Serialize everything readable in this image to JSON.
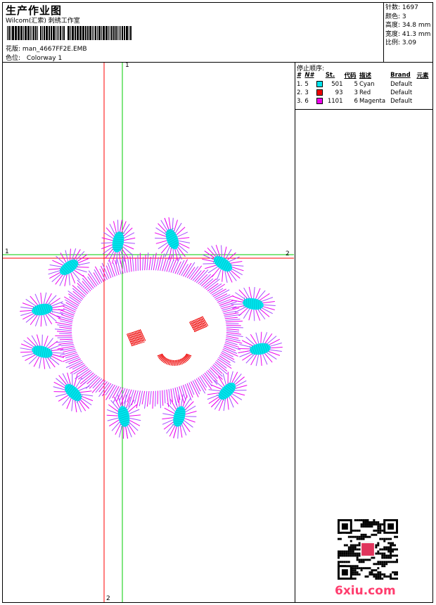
{
  "header": {
    "title": "生产作业图",
    "studio": "Wilcom(汇索) 刺绣工作室",
    "design_label": "花版:",
    "design_name": "man_4667FF2E.EMB",
    "colorway_label": "色位:",
    "colorway_name": "Colorway 1"
  },
  "stats": [
    {
      "label": "针数:",
      "value": "1697"
    },
    {
      "label": "颜色:",
      "value": "3"
    },
    {
      "label": "高度:",
      "value": "34.8 mm"
    },
    {
      "label": "宽度:",
      "value": "41.3 mm"
    },
    {
      "label": "比例:",
      "value": "3.09"
    }
  ],
  "stop_sequence": {
    "title": "停止顺序:",
    "headers": [
      "#",
      "N#",
      "St.",
      "代码",
      "描述",
      "Brand",
      "元素"
    ],
    "rows": [
      {
        "index": "1.",
        "n": "5",
        "color": "#00e5ee",
        "st": "501",
        "code": "5",
        "desc": "Cyan",
        "brand": "Default"
      },
      {
        "index": "2.",
        "n": "3",
        "color": "#ee0000",
        "st": "93",
        "code": "3",
        "desc": "Red",
        "brand": "Default"
      },
      {
        "index": "3.",
        "n": "6",
        "color": "#ee00ee",
        "st": "1101",
        "code": "6",
        "desc": "Magenta",
        "brand": "Default"
      }
    ]
  },
  "guides": {
    "v_green": "1",
    "h_green": "1",
    "h_red": "2",
    "v_red": "2"
  },
  "colors": {
    "cyan": "#00e5ee",
    "red": "#ee0000",
    "magenta": "#ee00ee",
    "purple": "#a64dff",
    "guide_green": "#00cc00",
    "guide_red": "#ff0000"
  },
  "watermark": "6xiu.com"
}
